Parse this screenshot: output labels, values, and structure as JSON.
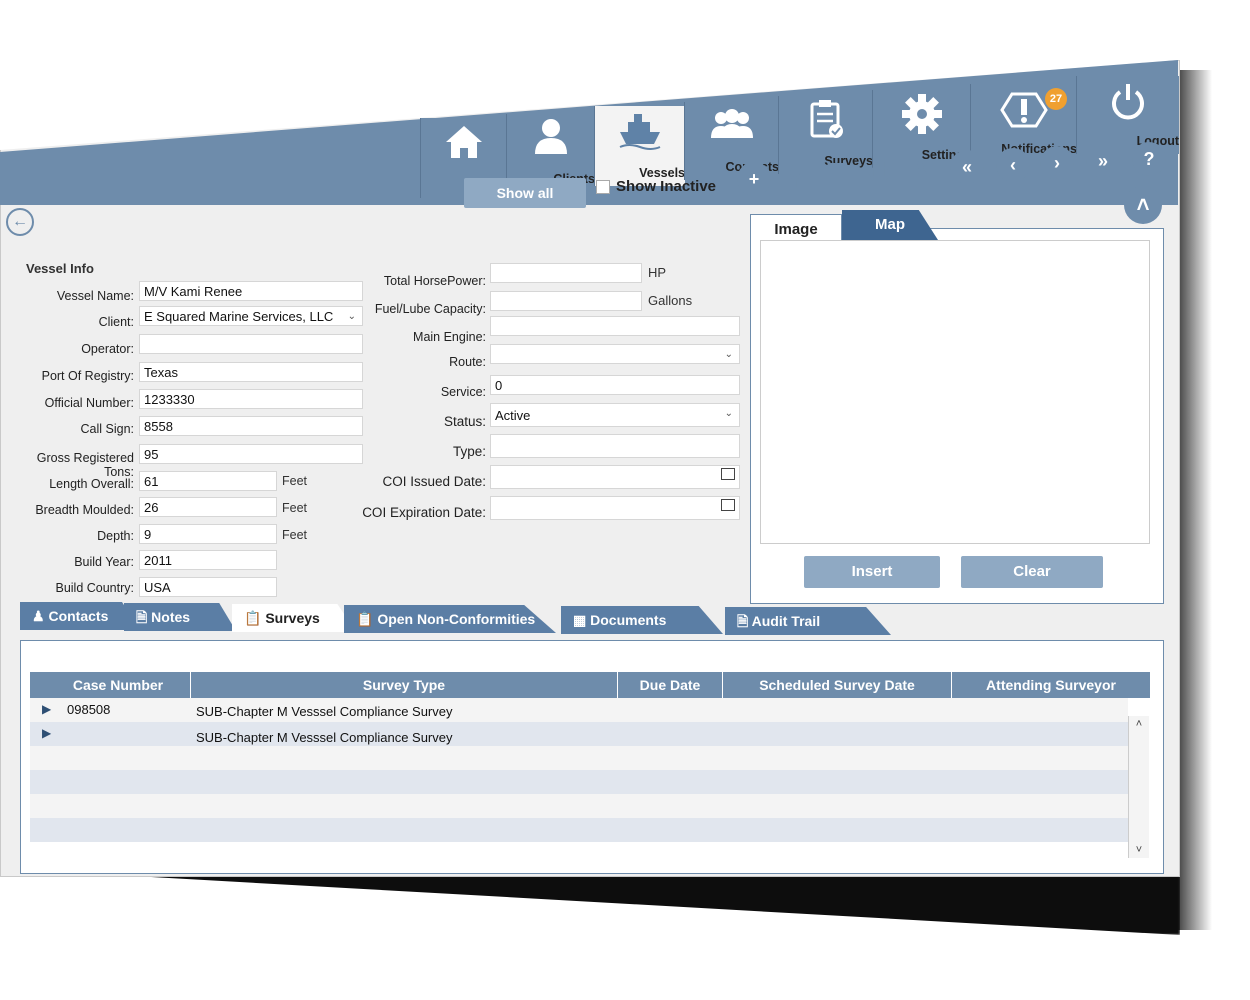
{
  "nav": [
    {
      "label": "Home",
      "icon": "home-icon"
    },
    {
      "label": "Clients",
      "icon": "person-icon"
    },
    {
      "label": "Vessels",
      "icon": "ship-icon"
    },
    {
      "label": "Contacts",
      "icon": "group-icon"
    },
    {
      "label": "Surveys",
      "icon": "clipboard-icon"
    },
    {
      "label": "Settings",
      "icon": "gear-icon"
    },
    {
      "label": "Notifications",
      "icon": "alert-icon",
      "badge": "27"
    },
    {
      "label": "Logout",
      "icon": "power-icon"
    }
  ],
  "toolbar": {
    "show_all": "Show all",
    "show_inactive": "Show Inactive"
  },
  "vessel_info": {
    "title": "Vessel Info",
    "vessel_name_label": "Vessel Name:",
    "vessel_name": "M/V Kami Renee",
    "client_label": "Client:",
    "client": "E Squared Marine Services, LLC",
    "operator_label": "Operator:",
    "operator": "",
    "port_label": "Port Of Registry:",
    "port": "Texas",
    "official_label": "Official Number:",
    "official": "1233330",
    "callsign_label": "Call Sign:",
    "callsign": "8558",
    "grt_label": "Gross Registered Tons:",
    "grt": "95",
    "loa_label": "Length Overall:",
    "loa": "61",
    "breadth_label": "Breadth Moulded:",
    "breadth": "26",
    "depth_label": "Depth:",
    "depth": "9",
    "build_year_label": "Build Year:",
    "build_year": "2011",
    "build_country_label": "Build Country:",
    "build_country": "USA",
    "feet": "Feet",
    "hp_label": "Total HorsePower:",
    "hp": "",
    "hp_unit": "HP",
    "fuel_label": "Fuel/Lube Capacity:",
    "fuel": "",
    "fuel_unit": "Gallons",
    "engine_label": "Main Engine:",
    "engine": "",
    "route_label": "Route:",
    "route": "",
    "service_label": "Service:",
    "service": "0",
    "status_label": "Status:",
    "status": "Active",
    "type_label": "Type:",
    "type": "",
    "coi_issued_label": "COI Issued Date:",
    "coi_issued": "",
    "coi_exp_label": "COI Expiration Date:",
    "coi_exp": ""
  },
  "image_panel": {
    "tab_image": "Image",
    "tab_map": "Map",
    "insert": "Insert",
    "clear": "Clear"
  },
  "bottom_tabs": [
    "Contacts",
    "Notes",
    "Surveys",
    "Open Non-Conformities",
    "Documents",
    "Audit Trail"
  ],
  "table": {
    "headers": [
      "Case Number",
      "Survey Type",
      "Due Date",
      "Scheduled Survey  Date",
      "Attending Surveyor"
    ],
    "rows": [
      {
        "case": "098508",
        "type": "SUB-Chapter M Vesssel Compliance Survey"
      },
      {
        "case": "",
        "type": "SUB-Chapter M Vesssel Compliance Survey"
      }
    ]
  }
}
